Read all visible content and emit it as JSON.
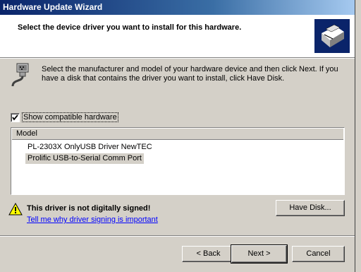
{
  "window": {
    "title": "Hardware Update Wizard"
  },
  "header": {
    "title": "Select the device driver you want to install for this hardware."
  },
  "instructions": "Select the manufacturer and model of your hardware device and then click Next. If you have a disk that contains the driver you want to install, click Have Disk.",
  "compatible_checkbox": {
    "label": "Show compatible hardware",
    "checked": true
  },
  "model_list": {
    "column": "Model",
    "items": [
      "PL-2303X OnlyUSB Driver NewTEC",
      "Prolific USB-to-Serial Comm Port"
    ],
    "selected_index": 1
  },
  "warning": {
    "text": "This driver is not digitally signed!",
    "link": "Tell me why driver signing is important",
    "icon": "warning-icon"
  },
  "buttons": {
    "have_disk": "Have Disk...",
    "back": "< Back",
    "next": "Next >",
    "cancel": "Cancel"
  }
}
